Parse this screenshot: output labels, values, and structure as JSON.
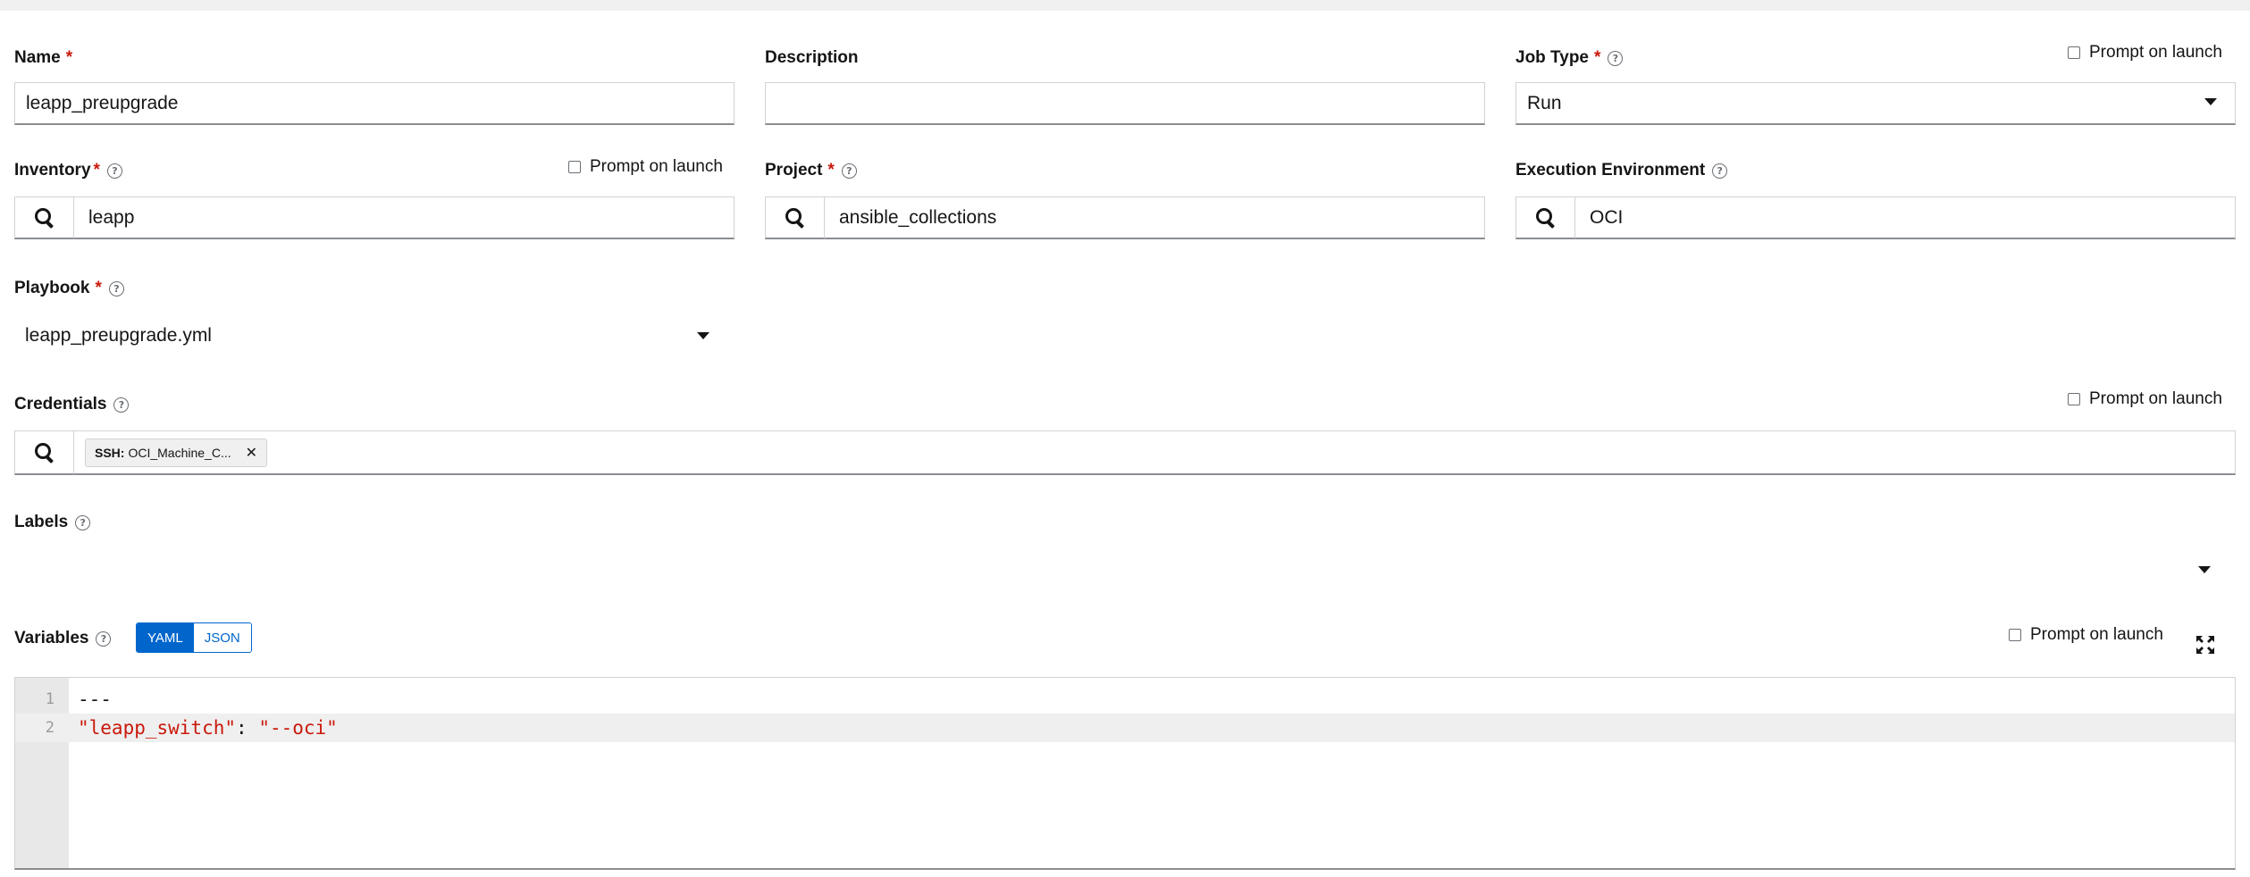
{
  "fields": {
    "name": {
      "label": "Name",
      "required": "*",
      "value": "leapp_preupgrade"
    },
    "description": {
      "label": "Description",
      "value": ""
    },
    "job_type": {
      "label": "Job Type",
      "required": "*",
      "value": "Run",
      "prompt": "Prompt on launch"
    },
    "inventory": {
      "label": "Inventory",
      "required": "*",
      "value": "leapp",
      "prompt": "Prompt on launch"
    },
    "project": {
      "label": "Project",
      "required": "*",
      "value": "ansible_collections"
    },
    "execution_environment": {
      "label": "Execution Environment",
      "value": "OCI"
    },
    "playbook": {
      "label": "Playbook",
      "required": "*",
      "value": "leapp_preupgrade.yml"
    },
    "credentials": {
      "label": "Credentials",
      "prompt": "Prompt on launch",
      "chips": [
        {
          "type": "SSH:",
          "name": "OCI_Machine_C..."
        }
      ]
    },
    "labels": {
      "label": "Labels"
    },
    "variables": {
      "label": "Variables",
      "modes": [
        "YAML",
        "JSON"
      ],
      "active_mode": "YAML",
      "prompt": "Prompt on launch",
      "lines": [
        {
          "num": "1",
          "text": "---"
        },
        {
          "num": "2",
          "key": "\"leapp_switch\"",
          "sep": ": ",
          "val": "\"--oci\""
        }
      ]
    }
  },
  "icons": {
    "help": "question-circle-icon",
    "search": "search-icon",
    "caret": "caret-down-icon",
    "remove": "times-icon",
    "expand": "expand-arrows-icon"
  },
  "colors": {
    "primary": "#0066cc",
    "required": "#c9190b",
    "code_string": "#c9190b"
  }
}
